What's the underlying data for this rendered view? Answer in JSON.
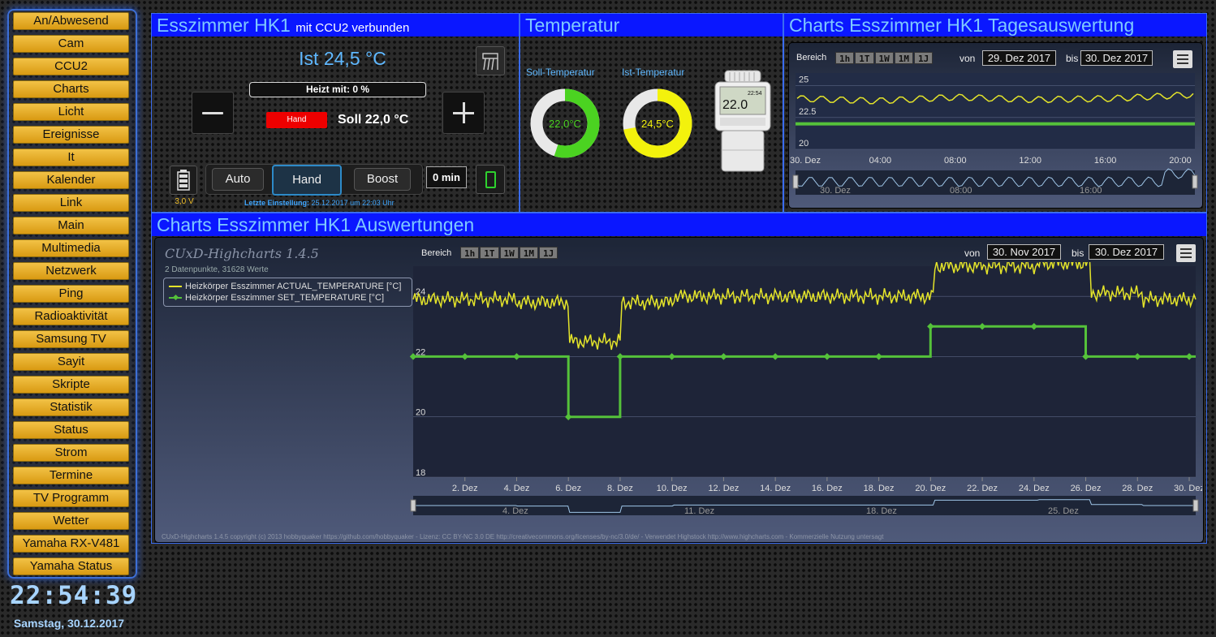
{
  "nav": {
    "items": [
      "An/Abwesend",
      "Cam",
      "CCU2",
      "Charts",
      "Licht",
      "Ereignisse",
      "It",
      "Kalender",
      "Link",
      "Main",
      "Multimedia",
      "Netzwerk",
      "Ping",
      "Radioaktivität",
      "Samsung TV",
      "Sayit",
      "Skripte",
      "Statistik",
      "Status",
      "Strom",
      "Termine",
      "TV Programm",
      "Wetter",
      "Yamaha RX-V481",
      "Yamaha Status"
    ]
  },
  "clock": {
    "time": "22:54:39",
    "date": "Samstag, 30.12.2017"
  },
  "hk": {
    "title": "Esszimmer HK1",
    "subtitle": "mit CCU2 verbunden",
    "ist": "Ist 24,5 °C",
    "heizt": "Heizt mit: 0 %",
    "mode_badge": "Hand",
    "soll": "Soll 22,0 °C",
    "battery": "3,0 V",
    "modes": [
      "Auto",
      "Hand",
      "Boost"
    ],
    "boost_time": "0 min",
    "last_setting_label": "Letzte Einstellung:",
    "last_setting_value": "25.12.2017 um 22:03 Uhr",
    "thermo_display": "22.0",
    "thermo_time": "22:54"
  },
  "temp": {
    "title": "Temperatur",
    "soll_label": "Soll-Temperatur",
    "ist_label": "Ist-Temperatur",
    "soll_value": "22,0°C",
    "ist_value": "24,5°C",
    "soll_fraction": 0.55,
    "ist_fraction": 0.72
  },
  "day": {
    "title": "Charts Esszimmer HK1 Tagesauswertung",
    "bereich": "Bereich",
    "ranges": [
      "1h",
      "1T",
      "1W",
      "1M",
      "1J"
    ],
    "von_label": "von",
    "von": "29. Dez 2017",
    "bis_label": "bis",
    "bis": "30. Dez 2017",
    "yticks": [
      "25",
      "22.5",
      "20"
    ],
    "xticks": [
      "30. Dez",
      "04:00",
      "08:00",
      "12:00",
      "16:00",
      "20:00"
    ],
    "nav_ticks": [
      "30. Dez",
      "08:00",
      "16:00"
    ]
  },
  "main": {
    "title": "Charts Esszimmer HK1 Auswertungen",
    "brand": "CUxD-Highcharts 1.4.5",
    "info": "2 Datenpunkte, 31628 Werte",
    "bereich": "Bereich",
    "ranges": [
      "1h",
      "1T",
      "1W",
      "1M",
      "1J"
    ],
    "von_label": "von",
    "von": "30. Nov 2017",
    "bis_label": "bis",
    "bis": "30. Dez 2017",
    "legend": [
      "Heizkörper Esszimmer ACTUAL_TEMPERATURE [°C]",
      "Heizkörper Esszimmer SET_TEMPERATURE [°C]"
    ],
    "yticks": [
      "24",
      "22",
      "20",
      "18"
    ],
    "xticks": [
      "2. Dez",
      "4. Dez",
      "6. Dez",
      "8. Dez",
      "10. Dez",
      "12. Dez",
      "14. Dez",
      "16. Dez",
      "18. Dez",
      "20. Dez",
      "22. Dez",
      "24. Dez",
      "26. Dez",
      "28. Dez",
      "30. Dez"
    ],
    "nav_ticks": [
      "4. Dez",
      "11. Dez",
      "18. Dez",
      "25. Dez"
    ],
    "copyright": "CUxD-Highcharts 1.4.5 copyright (c) 2013 hobbyquaker https://github.com/hobbyquaker - Lizenz: CC BY-NC 3.0 DE http://creativecommons.org/licenses/by-nc/3.0/de/ - Verwendet Highstock http://www.highcharts.com - Kommerzielle Nutzung untersagt"
  },
  "chart_data": [
    {
      "type": "line",
      "title": "",
      "x": [
        "30. Dez",
        "04:00",
        "08:00",
        "12:00",
        "16:00",
        "20:00"
      ],
      "ylim": [
        20,
        26
      ],
      "series": [
        {
          "name": "",
          "values": [
            24.0,
            23.8,
            24.1,
            23.9,
            24.0,
            24.3
          ]
        },
        {
          "name": "",
          "values": [
            22,
            22,
            22,
            22,
            22,
            22
          ]
        }
      ]
    },
    {
      "type": "line",
      "title": "",
      "x": [
        "30. Nov",
        "2. Dez",
        "4. Dez",
        "6. Dez",
        "8. Dez",
        "10. Dez",
        "12. Dez",
        "14. Dez",
        "16. Dez",
        "18. Dez",
        "20. Dez",
        "22. Dez",
        "24. Dez",
        "26. Dez",
        "28. Dez",
        "30. Dez"
      ],
      "ylim": [
        18,
        25
      ],
      "series": [
        {
          "name": "Heizkörper Esszimmer ACTUAL_TEMPERATURE [°C]",
          "values": [
            23.9,
            23.9,
            23.8,
            22.5,
            23.8,
            24.0,
            24.0,
            24.0,
            24.0,
            24.0,
            25.0,
            25.0,
            25.1,
            24.1,
            23.9,
            24.0
          ]
        },
        {
          "name": "Heizkörper Esszimmer SET_TEMPERATURE [°C]",
          "values": [
            22,
            22,
            22,
            20,
            22,
            22,
            22,
            22,
            22,
            22,
            23,
            23,
            23,
            22,
            22,
            22
          ]
        }
      ]
    }
  ],
  "colors": {
    "actual": "#e4e42a",
    "set": "#55c23a",
    "title_bar": "#0a17ff"
  }
}
